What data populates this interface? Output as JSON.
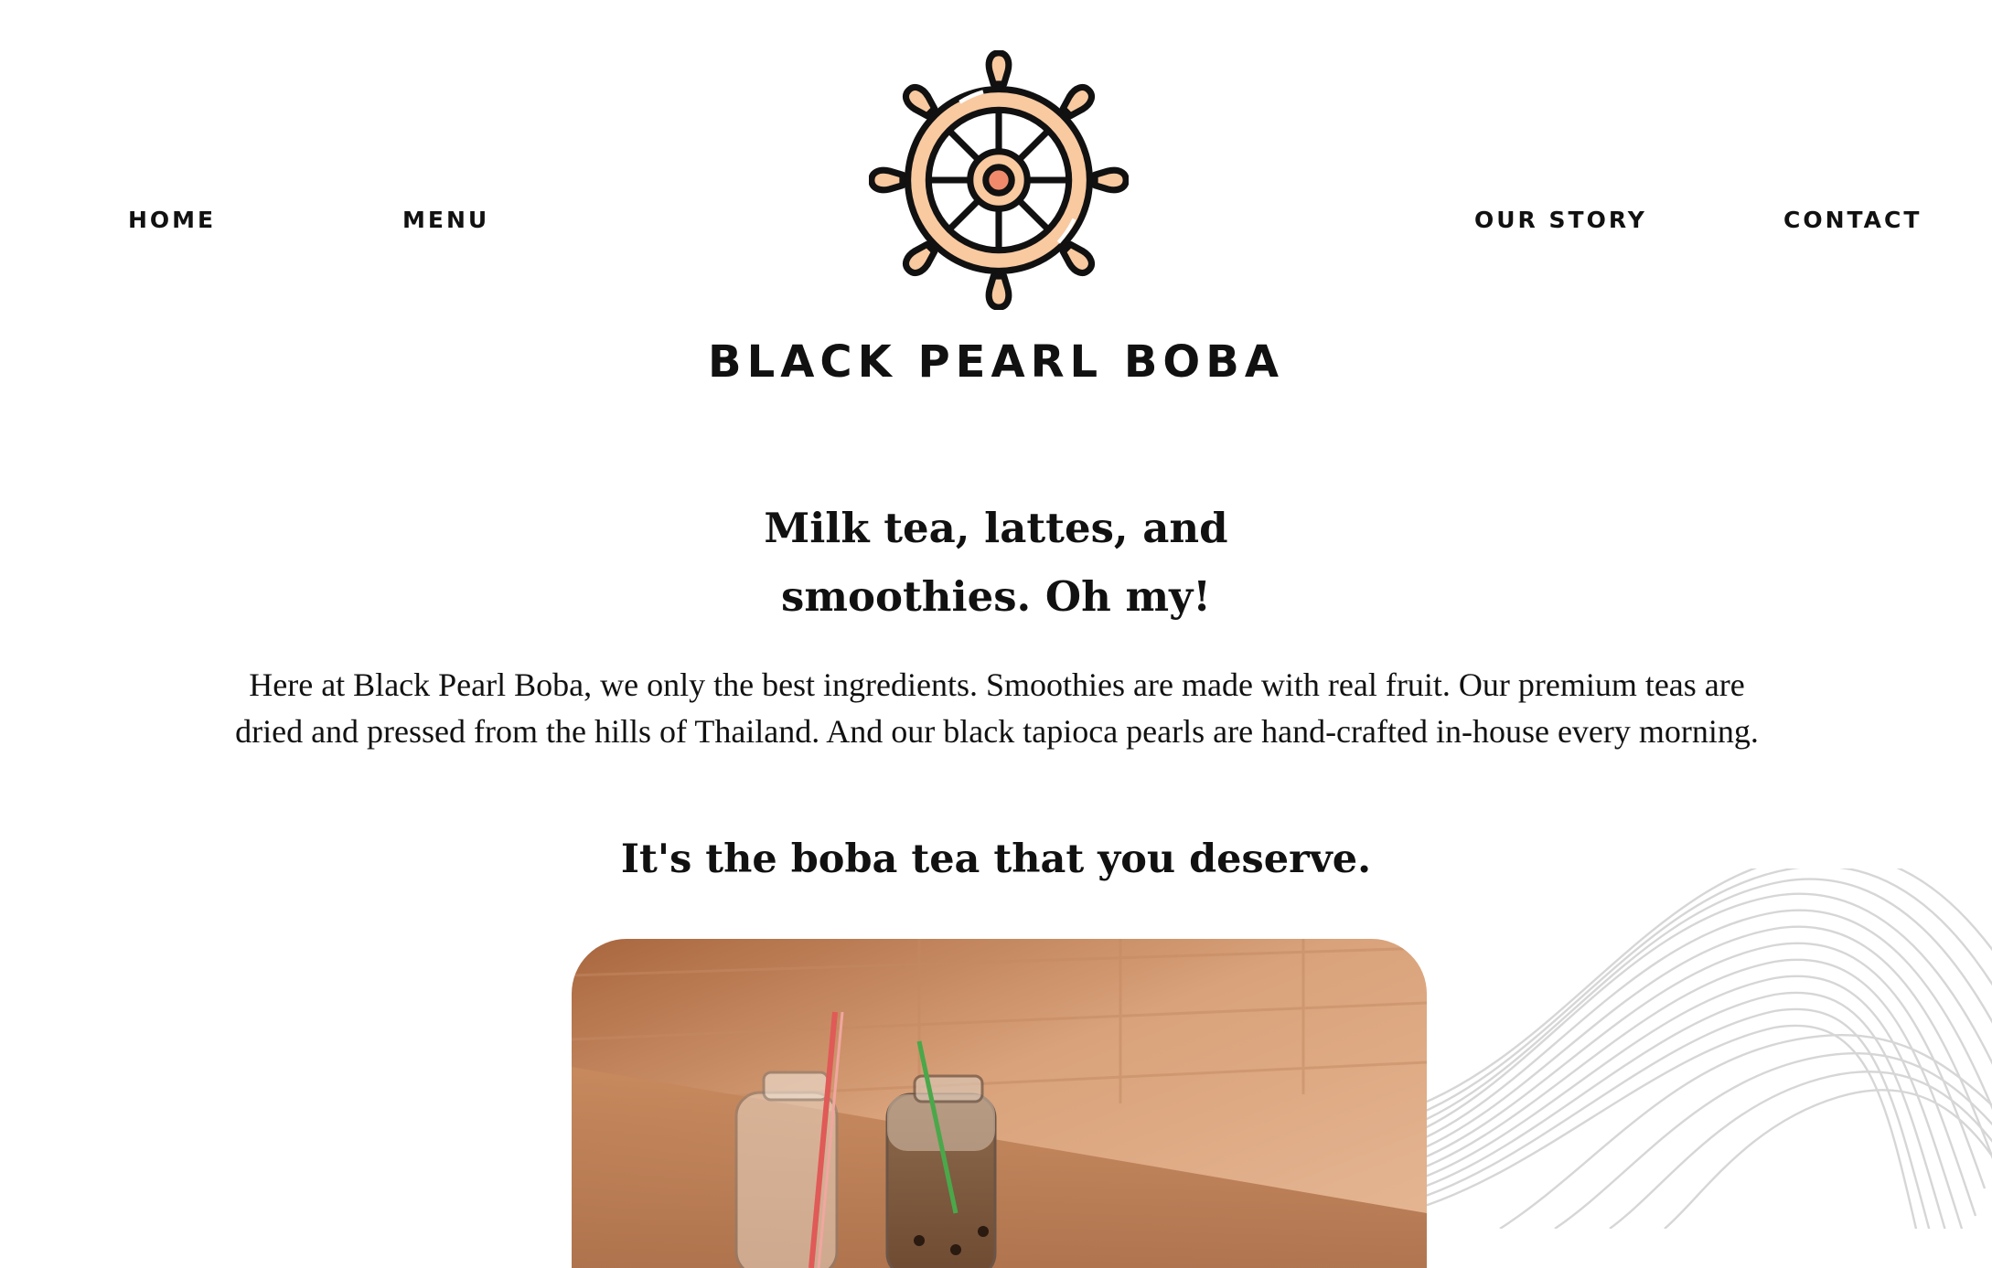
{
  "nav": {
    "home": "HOME",
    "menu": "MENU",
    "our_story": "OUR STORY",
    "contact": "CONTACT"
  },
  "brand": {
    "name": "BLACK PEARL BOBA",
    "logo_icon": "ship-wheel-icon"
  },
  "hero": {
    "headline_line1": "Milk tea, lattes, and",
    "headline_line2": "smoothies. Oh my!",
    "intro": "Here at Black Pearl Boba, we only the best ingredients. Smoothies are made with real fruit. Our premium teas are dried and pressed from the hills of Thailand. And our black tapioca pearls are hand-crafted in-house every morning.",
    "tagline": "It's the boba tea that you deserve."
  },
  "colors": {
    "text": "#111111",
    "logo_peach": "#f9c9a0",
    "logo_coral": "#f08a6a",
    "wave_line": "#d6d6d6",
    "wood": "#c88a5e"
  }
}
